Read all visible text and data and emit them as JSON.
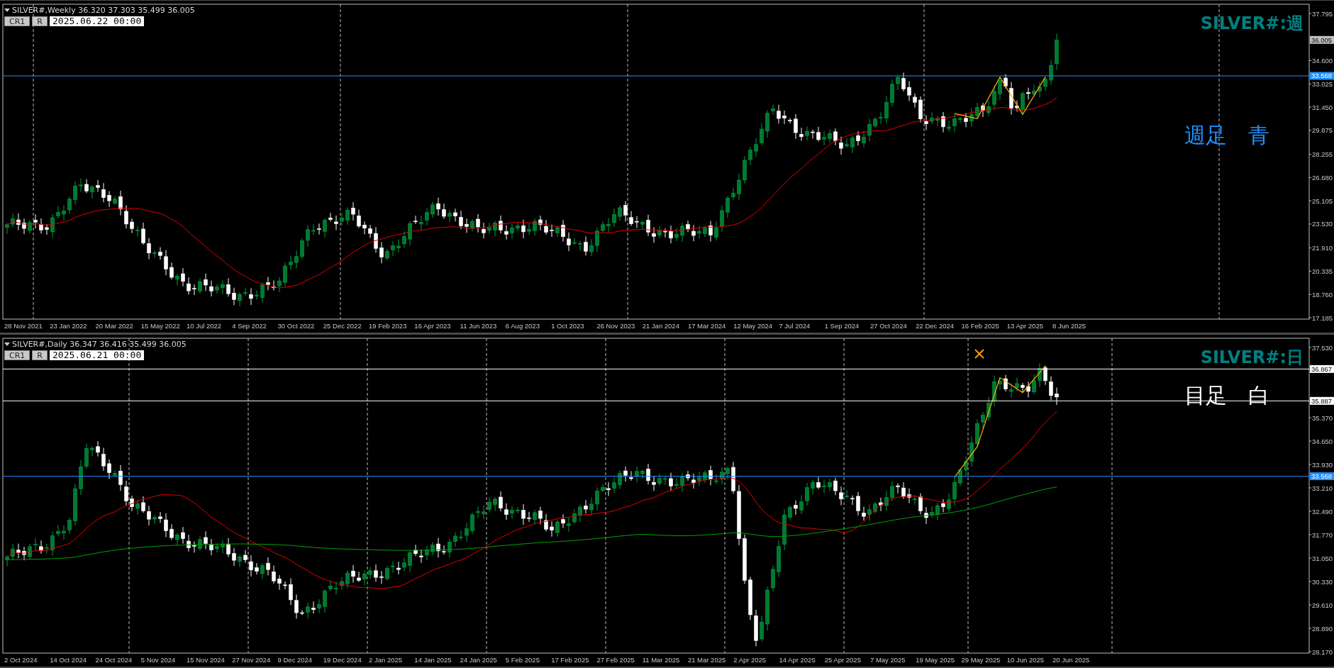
{
  "panels": [
    {
      "kind": "weekly",
      "header": "SILVER#,Weekly  36.320 37.303 35.499 36.005",
      "buttons": [
        "CR1",
        "R"
      ],
      "date_field": "2025.06.22 00:00",
      "title": "SILVER#:週",
      "note": {
        "text": "週足　青",
        "color": "#1e90ff"
      },
      "price_ticks": [
        "37.795",
        "34.600",
        "33.025",
        "31.450",
        "29.875",
        "28.255",
        "26.680",
        "25.105",
        "23.530",
        "21.910",
        "20.335",
        "18.760",
        "17.185"
      ],
      "price_labels": [
        {
          "text": "36.005",
          "kind": "bid"
        },
        {
          "text": "33.568",
          "kind": "line",
          "color": "#1e90ff"
        }
      ],
      "date_labels": [
        "28 Nov 2021",
        "23 Jan 2022",
        "20 Mar 2022",
        "15 May 2022",
        "10 Jul 2022",
        "4 Sep 2022",
        "30 Oct 2022",
        "25 Dec 2022",
        "19 Feb 2023",
        "16 Apr 2023",
        "11 Jun 2023",
        "6 Aug 2023",
        "1 Oct 2023",
        "26 Nov 2023",
        "21 Jan 2024",
        "17 Mar 2024",
        "12 May 2024",
        "7 Jul 2024",
        "1 Sep 2024",
        "27 Oct 2024",
        "22 Dec 2024",
        "16 Feb 2025",
        "13 Apr 2025",
        "8 Jun 2025"
      ]
    },
    {
      "kind": "daily",
      "header": "SILVER#,Daily  36.347 36.416 35.499 36.005",
      "buttons": [
        "CR1",
        "R"
      ],
      "date_field": "2025.06.21 00:00",
      "title": "SILVER#:日",
      "note": {
        "text": "目足　白",
        "color": "#ffffff"
      },
      "price_ticks": [
        "37.530",
        "35.370",
        "34.650",
        "33.930",
        "33.210",
        "32.490",
        "31.770",
        "31.050",
        "30.330",
        "29.610",
        "28.890",
        "28.170"
      ],
      "price_labels": [
        {
          "text": "36.867",
          "kind": "line",
          "color": "#ffffff"
        },
        {
          "text": "35.887",
          "kind": "line",
          "color": "#ffffff"
        },
        {
          "text": "33.568",
          "kind": "line",
          "color": "#1e90ff"
        }
      ],
      "date_labels": [
        "2 Oct 2024",
        "14 Oct 2024",
        "24 Oct 2024",
        "5 Nov 2024",
        "15 Nov 2024",
        "27 Nov 2024",
        "9 Dec 2024",
        "19 Dec 2024",
        "2 Jan 2025",
        "14 Jan 2025",
        "24 Jan 2025",
        "5 Feb 2025",
        "17 Feb 2025",
        "27 Feb 2025",
        "11 Mar 2025",
        "21 Mar 2025",
        "2 Apr 2025",
        "14 Apr 2025",
        "25 Apr 2025",
        "7 May 2025",
        "19 May 2025",
        "29 May 2025",
        "10 Jun 2025",
        "20 Jun 2025"
      ]
    }
  ]
}
